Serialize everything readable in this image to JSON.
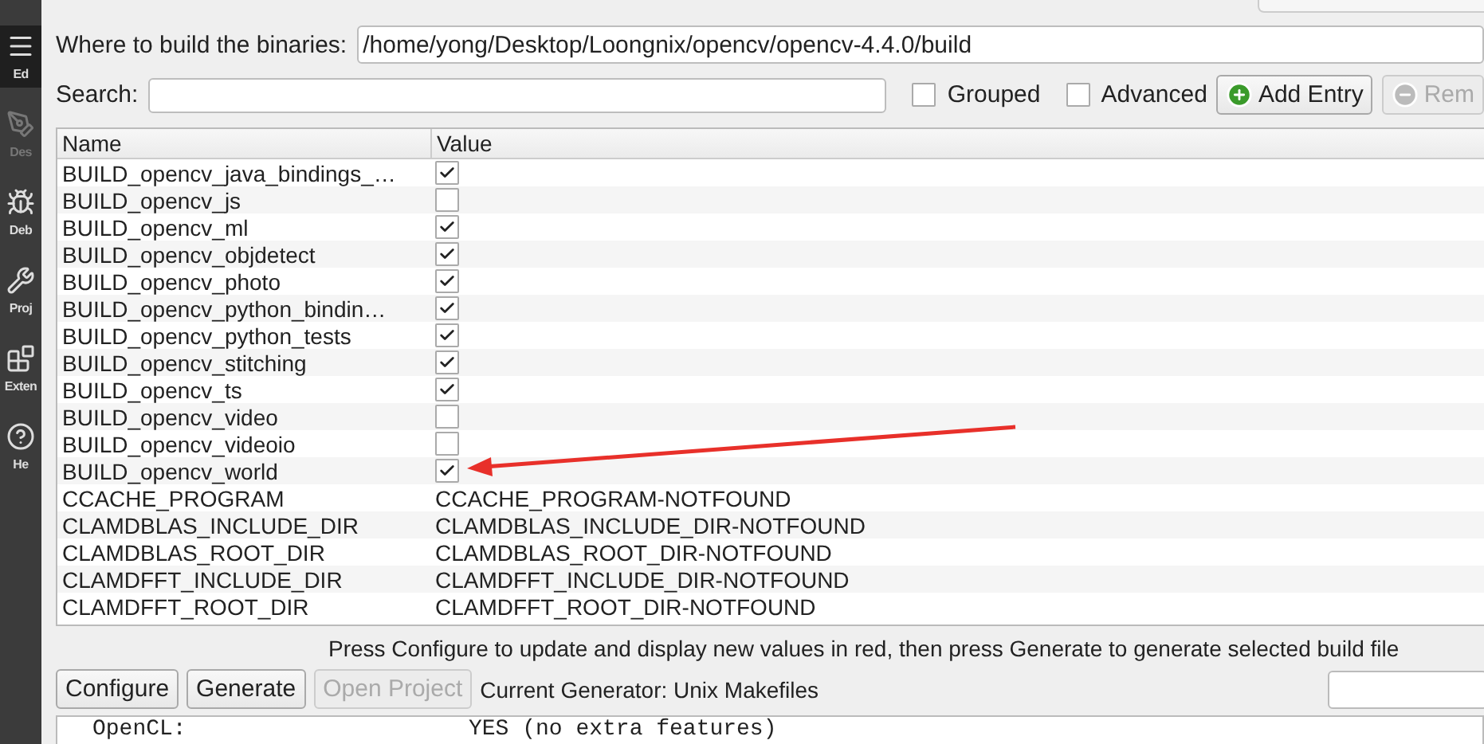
{
  "sidebar": {
    "items": [
      {
        "label": "Ed",
        "selected": true,
        "disabled": false
      },
      {
        "label": "Des",
        "selected": false,
        "disabled": true
      },
      {
        "label": "Deb",
        "selected": false,
        "disabled": false
      },
      {
        "label": "Proj",
        "selected": false,
        "disabled": false
      },
      {
        "label": "Exten",
        "selected": false,
        "disabled": false
      },
      {
        "label": "He",
        "selected": false,
        "disabled": false
      }
    ]
  },
  "build_dir": {
    "label": "Where to build the binaries:",
    "value": "/home/yong/Desktop/Loongnix/opencv/opencv-4.4.0/build"
  },
  "search": {
    "label": "Search:"
  },
  "options": [
    {
      "label": "Grouped",
      "checked": false
    },
    {
      "label": "Advanced",
      "checked": false
    }
  ],
  "entry_buttons": [
    {
      "label": "Add Entry",
      "kind": "add",
      "disabled": false
    },
    {
      "label": "Rem",
      "kind": "remove",
      "disabled": true
    }
  ],
  "table": {
    "columns": [
      "Name",
      "Value"
    ],
    "rows": [
      {
        "name": "BUILD_opencv_java_bindings_…",
        "kind": "bool",
        "checked": true
      },
      {
        "name": "BUILD_opencv_js",
        "kind": "bool",
        "checked": false
      },
      {
        "name": "BUILD_opencv_ml",
        "kind": "bool",
        "checked": true
      },
      {
        "name": "BUILD_opencv_objdetect",
        "kind": "bool",
        "checked": true
      },
      {
        "name": "BUILD_opencv_photo",
        "kind": "bool",
        "checked": true
      },
      {
        "name": "BUILD_opencv_python_bindin…",
        "kind": "bool",
        "checked": true
      },
      {
        "name": "BUILD_opencv_python_tests",
        "kind": "bool",
        "checked": true
      },
      {
        "name": "BUILD_opencv_stitching",
        "kind": "bool",
        "checked": true
      },
      {
        "name": "BUILD_opencv_ts",
        "kind": "bool",
        "checked": true
      },
      {
        "name": "BUILD_opencv_video",
        "kind": "bool",
        "checked": false
      },
      {
        "name": "BUILD_opencv_videoio",
        "kind": "bool",
        "checked": false
      },
      {
        "name": "BUILD_opencv_world",
        "kind": "bool",
        "checked": true
      },
      {
        "name": "CCACHE_PROGRAM",
        "kind": "text",
        "value": "CCACHE_PROGRAM-NOTFOUND"
      },
      {
        "name": "CLAMDBLAS_INCLUDE_DIR",
        "kind": "text",
        "value": "CLAMDBLAS_INCLUDE_DIR-NOTFOUND"
      },
      {
        "name": "CLAMDBLAS_ROOT_DIR",
        "kind": "text",
        "value": "CLAMDBLAS_ROOT_DIR-NOTFOUND"
      },
      {
        "name": "CLAMDFFT_INCLUDE_DIR",
        "kind": "text",
        "value": "CLAMDFFT_INCLUDE_DIR-NOTFOUND"
      },
      {
        "name": "CLAMDFFT_ROOT_DIR",
        "kind": "text",
        "value": "CLAMDFFT_ROOT_DIR-NOTFOUND"
      }
    ]
  },
  "status_message": "Press Configure to update and display new values in red, then press Generate to generate selected build file",
  "actions": [
    {
      "label": "Configure",
      "disabled": false
    },
    {
      "label": "Generate",
      "disabled": false
    },
    {
      "label": "Open Project",
      "disabled": true
    }
  ],
  "generator": "Current Generator: Unix Makefiles",
  "output": [
    {
      "key": "OpenCL:",
      "value": "YES (no extra features)"
    }
  ]
}
